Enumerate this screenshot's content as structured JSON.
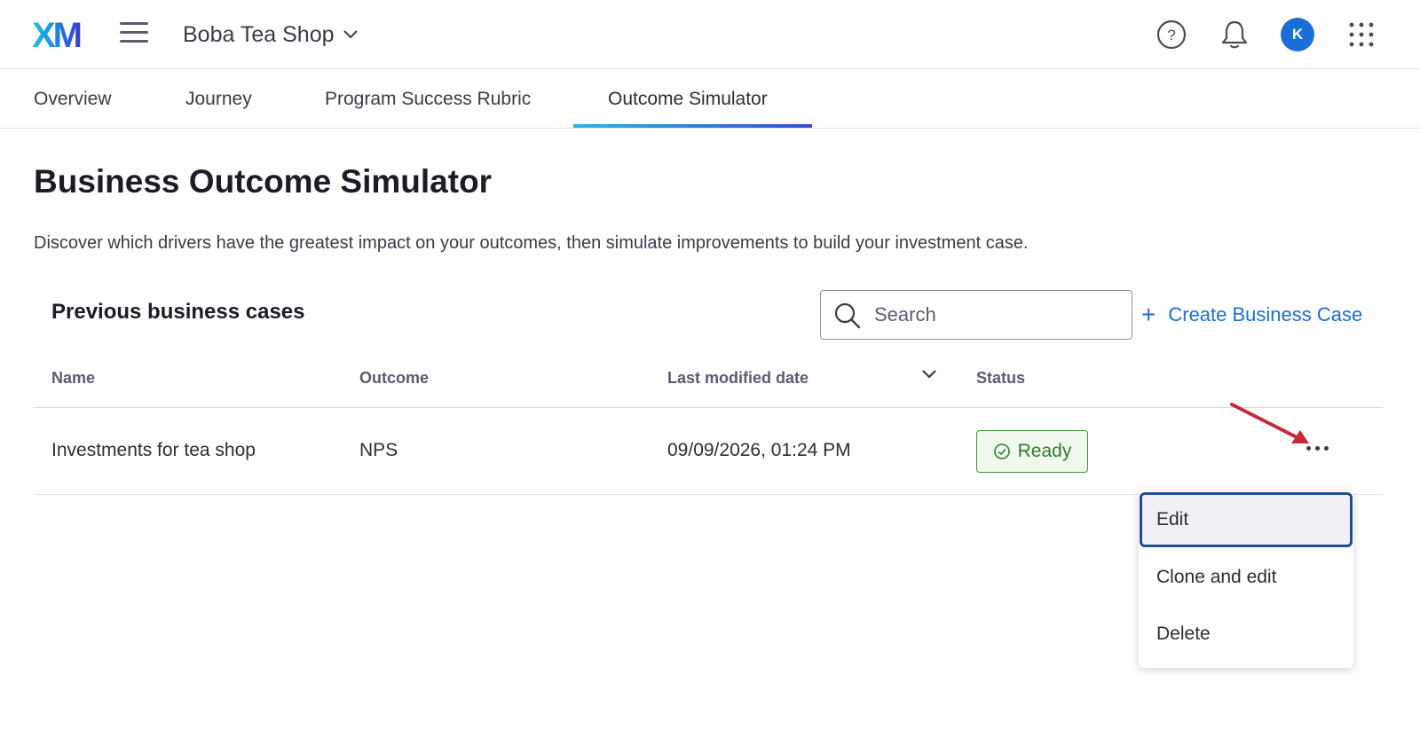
{
  "header": {
    "logo_text": "XM",
    "project_name": "Boba Tea Shop",
    "avatar_initial": "K",
    "icons": [
      "menu-icon",
      "help-icon",
      "bell-icon",
      "app-grid-icon"
    ]
  },
  "tabs": [
    {
      "label": "Overview",
      "active": false
    },
    {
      "label": "Journey",
      "active": false
    },
    {
      "label": "Program Success Rubric",
      "active": false
    },
    {
      "label": "Outcome Simulator",
      "active": true
    }
  ],
  "main": {
    "title": "Business Outcome Simulator",
    "description": "Discover which drivers have the greatest impact on your outcomes, then simulate improvements to build your investment case."
  },
  "cases": {
    "section_title": "Previous business cases",
    "search_placeholder": "Search",
    "create_label": "Create Business Case",
    "columns": [
      "Name",
      "Outcome",
      "Last modified date",
      "Status"
    ],
    "rows": [
      {
        "name": "Investments for tea shop",
        "outcome": "NPS",
        "modified": "09/09/2026, 01:24 PM",
        "status": "Ready"
      }
    ]
  },
  "row_menu": {
    "items": [
      "Edit",
      "Clone and edit",
      "Delete"
    ],
    "focused_index": 0
  },
  "colors": {
    "accent": "#1a6fd6",
    "ready_green": "#2f7d2a",
    "annotation_arrow": "#c8283a",
    "focus_border": "#1f4e8c"
  }
}
